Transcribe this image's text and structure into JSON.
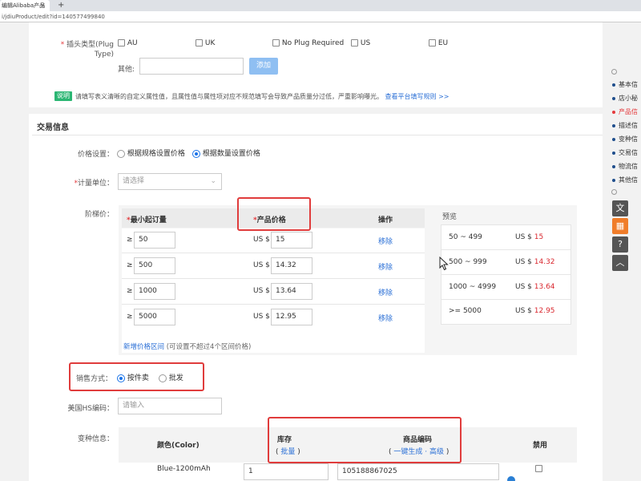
{
  "browser": {
    "tab_title": "编辑Alibaba产品",
    "tab_close": "×",
    "new_tab": "+",
    "url": "i/jdiuProduct/edit?id=140577499840"
  },
  "plug": {
    "label": "插头类型(Plug Type)",
    "label_line1": "插头类型(Plug",
    "label_line2": "Type)",
    "options": [
      "AU",
      "UK",
      "No Plug Required",
      "US",
      "EU"
    ],
    "other_label": "其他:",
    "other_value": "",
    "add_button": "添加"
  },
  "notice": {
    "badge": "说明",
    "text": "请填写表义清晰的自定义属性值，且属性值与属性项对应不规范填写会导致产品质量分过低，严重影响曝光。",
    "link": "查看平台填写规则 >>"
  },
  "trade": {
    "section_title": "交易信息",
    "price_setting_label": "价格设置：",
    "price_options": [
      "根据规格设置价格",
      "根据数量设置价格"
    ],
    "unit_label": "计量单位：",
    "unit_placeholder": "请选择",
    "ladder_label": "阶梯价：",
    "col_min_qty": "最小起订量",
    "col_price": "产品价格",
    "col_action": "操作",
    "preview_title": "预览",
    "geq": "≥",
    "currency": "US $",
    "remove": "移除",
    "rows": [
      {
        "qty": "50",
        "price": "15"
      },
      {
        "qty": "500",
        "price": "14.32"
      },
      {
        "qty": "1000",
        "price": "13.64"
      },
      {
        "qty": "5000",
        "price": "12.95"
      }
    ],
    "preview": [
      {
        "range": "50 ~ 499",
        "currency": "US $",
        "price": "15"
      },
      {
        "range": "500 ~ 999",
        "currency": "US $",
        "price": "14.32"
      },
      {
        "range": "1000 ~ 4999",
        "currency": "US $",
        "price": "13.64"
      },
      {
        "range": ">= 5000",
        "currency": "US $",
        "price": "12.95"
      }
    ],
    "add_range_link": "新增价格区间",
    "add_range_hint": "(可设置不超过4个区间价格)",
    "sale_label": "销售方式：",
    "sale_options": [
      "按件卖",
      "批发"
    ],
    "hs_label": "美国HS编码：",
    "hs_placeholder": "请输入",
    "variant_label": "变种信息：",
    "var_col_color": "颜色(Color)",
    "var_col_stock": "库存",
    "var_col_stock_sub": "批量",
    "var_col_code": "商品编码",
    "var_col_code_sub": "一键生成 · 高级",
    "var_col_disable": "禁用",
    "variant_row": {
      "color": "Blue-1200mAh",
      "stock": "1",
      "code": "105188867025"
    }
  },
  "sidebar": {
    "items": [
      "基本信",
      "店小秘",
      "产品信",
      "描述信",
      "变种信",
      "交易信",
      "物流信",
      "其他信"
    ],
    "active_index": 2,
    "active_color": "#e4393c"
  },
  "colors": {
    "accent": "#1a73e8",
    "highlight_box": "#e03c3c",
    "price_red": "#d9272e",
    "notice_badge": "#2bb673"
  }
}
